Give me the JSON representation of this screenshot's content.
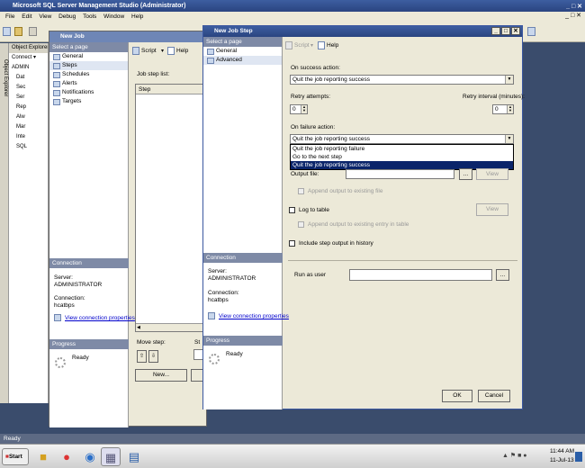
{
  "app": {
    "title": "Microsoft SQL Server Management Studio (Administrator)",
    "menu": [
      "File",
      "Edit",
      "View",
      "Debug",
      "Tools",
      "Window",
      "Help"
    ],
    "status": "Ready"
  },
  "object_explorer": {
    "tab_title": "Object Explorer",
    "side_label": "Object Explorer",
    "connect_label": "Connect ▾",
    "tree": [
      "ADMIN",
      "Dat",
      "Sec",
      "Ser",
      "Rep",
      "Alw",
      "Mar",
      "Inte",
      "SQL"
    ]
  },
  "job_dialog": {
    "title": "New Job",
    "select_page": "Select a page",
    "pages": [
      "General",
      "Steps",
      "Schedules",
      "Alerts",
      "Notifications",
      "Targets"
    ],
    "script_label": "Script",
    "help_label": "Help",
    "job_step_list": "Job step list:",
    "step_col": "Step",
    "connection_head": "Connection",
    "server_label": "Server:",
    "server_value": "ADMINISTRATOR",
    "connection_label": "Connection:",
    "connection_value": "hcatbps",
    "view_props": "View connection properties",
    "progress_head": "Progress",
    "progress_status": "Ready",
    "move_step": "Move step:",
    "start_fragment": "St",
    "new_button": "New..."
  },
  "step_dialog": {
    "title": "New Job Step",
    "select_page": "Select a page",
    "pages": [
      "General",
      "Advanced"
    ],
    "script_label": "Script",
    "help_label": "Help",
    "on_success_label": "On success action:",
    "on_success_value": "Quit the job reporting success",
    "retry_attempts_label": "Retry attempts:",
    "retry_attempts_value": "0",
    "retry_interval_label": "Retry interval (minutes):",
    "retry_interval_value": "0",
    "on_failure_label": "On failure action:",
    "on_failure_value": "Quit the job reporting success",
    "failure_options": [
      "Quit the job reporting failure",
      "Go to the next step",
      "Quit the job reporting success"
    ],
    "output_file_label": "Output file:",
    "browse_label": "...",
    "view_label": "View",
    "append_output_file": "Append output to existing file",
    "log_to_table": "Log to table",
    "append_output_table": "Append output to existing entry in table",
    "include_history": "Include step output in history",
    "run_as_user": "Run as user",
    "connection_head": "Connection",
    "server_label": "Server:",
    "server_value": "ADMINISTRATOR",
    "connection_label": "Connection:",
    "connection_value": "hcatbps",
    "view_props": "View connection properties",
    "progress_head": "Progress",
    "progress_status": "Ready",
    "ok": "OK",
    "cancel": "Cancel"
  },
  "taskbar": {
    "start": "Start",
    "time": "11:44 AM",
    "date": "11-Jul-13"
  }
}
